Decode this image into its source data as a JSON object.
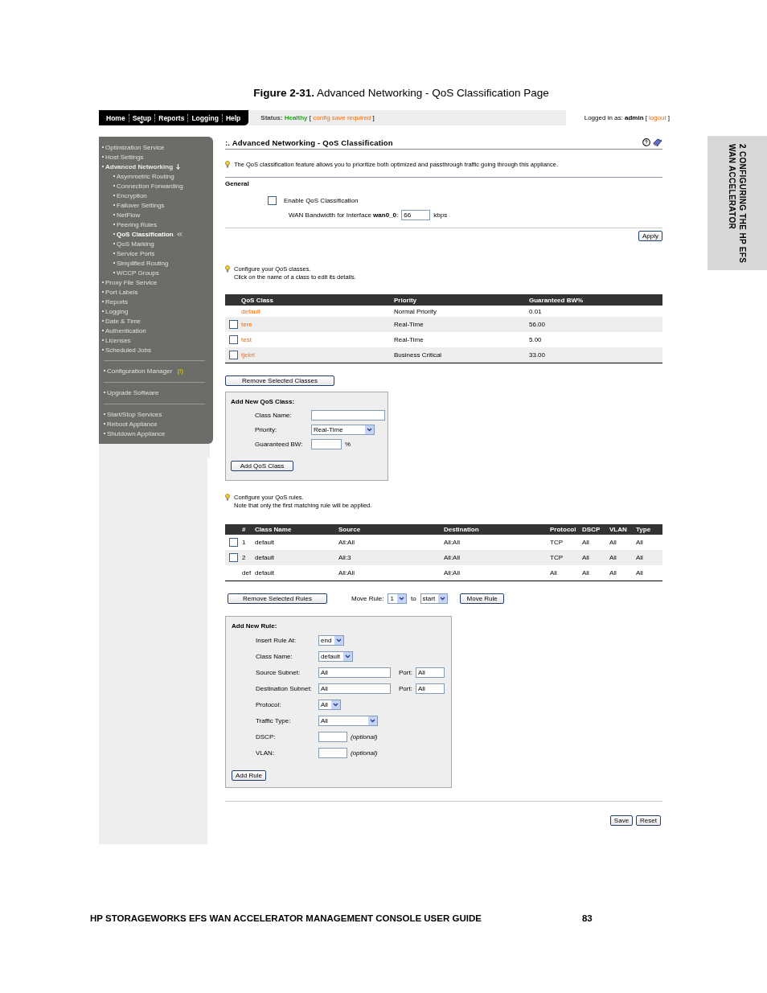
{
  "figure_caption": {
    "label": "Figure 2-31.",
    "text": "Advanced Networking - QoS Classification Page"
  },
  "side_tab": {
    "line_1": "2 CONFIGURING THE HP EFS",
    "line_2": "WAN ACCELERATOR"
  },
  "nav": [
    {
      "label": "Home",
      "selected": false
    },
    {
      "label": "Setup",
      "selected": true
    },
    {
      "label": "Reports",
      "selected": false
    },
    {
      "label": "Logging",
      "selected": false
    },
    {
      "label": "Help",
      "selected": false
    }
  ],
  "status": {
    "label": "Status:",
    "value": "Healthy",
    "bracket_open": "[",
    "note": "config save required",
    "bracket_close": "]"
  },
  "login": {
    "prefix": "Logged in as: **admin** [",
    "link": "logout",
    "suffix": "]"
  },
  "sidebar": [
    {
      "items": [
        {
          "label": "Optimization Service",
          "selected": false
        },
        {
          "label": "Host Settings",
          "selected": false
        },
        {
          "label": "Advanced Networking",
          "selected": false,
          "expanded": true,
          "children": [
            {
              "label": "Asymmetric Routing",
              "selected": false
            },
            {
              "label": "Connection Forwarding",
              "selected": false
            },
            {
              "label": "Encryption",
              "selected": false
            },
            {
              "label": "Failover Settings",
              "selected": false
            },
            {
              "label": "NetFlow",
              "selected": false
            },
            {
              "label": "Peering Rules",
              "selected": false
            },
            {
              "label": "QoS Classification",
              "selected": true
            },
            {
              "label": "QoS Marking",
              "selected": false
            },
            {
              "label": "Service Ports",
              "selected": false
            },
            {
              "label": "Simplified Routing",
              "selected": false
            },
            {
              "label": "WCCP Groups",
              "selected": false
            }
          ]
        },
        {
          "label": "Proxy File Service",
          "selected": false
        },
        {
          "label": "Port Labels",
          "selected": false
        },
        {
          "label": "Reports",
          "selected": false
        },
        {
          "label": "Logging",
          "selected": false
        },
        {
          "label": "Date & Time",
          "selected": false
        },
        {
          "label": "Authentication",
          "selected": false
        },
        {
          "label": "Licenses",
          "selected": false
        },
        {
          "label": "Scheduled Jobs",
          "selected": false
        }
      ]
    },
    {
      "items": [
        {
          "label": "Configuration Manager",
          "selected": false,
          "badge": "(!)"
        }
      ]
    },
    {
      "items": [
        {
          "label": "Upgrade Software",
          "selected": false
        }
      ]
    },
    {
      "items": [
        {
          "label": "Start/Stop Services",
          "selected": false
        },
        {
          "label": "Reboot Appliance",
          "selected": false
        },
        {
          "label": "Shutdown Appliance",
          "selected": false
        }
      ]
    }
  ],
  "page_title": ":. Advanced Networking - QoS Classification",
  "intro": "The QoS classification feature allows you to prioritize both optimized and passthrough traffic going through this appliance.",
  "general": {
    "heading": "General",
    "enable": {
      "label": "Enable QoS Classification",
      "checked": false
    },
    "bandwidth": {
      "label": "WAN Bandwidth for Interface **wan0_0**:",
      "value": "66",
      "unit": "kbps"
    },
    "apply": "Apply"
  },
  "classes": {
    "hint": [
      "Configure your QoS classes.",
      "Click on the name of a class to edit its details."
    ],
    "columns": [
      "QoS Class",
      "Priority",
      "Guaranteed BW%"
    ],
    "rows": [
      {
        "name": "default",
        "priority": "Normal Priority",
        "bandwidth": "0.01"
      },
      {
        "checked": false,
        "name": "tere",
        "priority": "Real-Time",
        "bandwidth": "56.00"
      },
      {
        "checked": false,
        "name": "test",
        "priority": "Real-Time",
        "bandwidth": "5.00"
      },
      {
        "checked": false,
        "name": "tjekrl",
        "priority": "Business Critical",
        "bandwidth": "33.00"
      }
    ],
    "remove": "Remove Selected Classes"
  },
  "add_class": {
    "title": "Add New QoS Class:",
    "fields": [
      {
        "kind": "text",
        "label": "Class Name:"
      },
      {
        "kind": "select",
        "label": "Priority:",
        "value": "Real-Time"
      },
      {
        "kind": "text",
        "label": "Guaranteed BW:",
        "unit": "%"
      }
    ],
    "button": "Add QoS Class"
  },
  "rules": {
    "hint": [
      "Configure your QoS rules.",
      "Note that only the first matching rule will be applied."
    ],
    "columns": [
      "#",
      "Class Name",
      "Source",
      "Destination",
      "Protocol",
      "DSCP",
      "VLAN",
      "Type"
    ],
    "rows": [
      {
        "checked": false,
        "cells": [
          "1",
          "default",
          "All:All",
          "All:All",
          "TCP",
          "All",
          "All",
          "All"
        ]
      },
      {
        "checked": false,
        "cells": [
          "2",
          "default",
          "All:3",
          "All:All",
          "TCP",
          "All",
          "All",
          "All"
        ]
      },
      {
        "cells": [
          "def",
          "default",
          "All:All",
          "All:All",
          "All",
          "All",
          "All",
          "All"
        ]
      }
    ],
    "remove": "Remove Selected Rules",
    "move_label": "Move Rule:",
    "move_from": "1",
    "to_label": "to",
    "move_to": "start",
    "move_button": "Move Rule"
  },
  "add_rule": {
    "title": "Add New Rule:",
    "fields": [
      {
        "kind": "select",
        "label": "Insert Rule At:",
        "value": "end"
      },
      {
        "kind": "select",
        "label": "Class Name:",
        "value": "default"
      },
      {
        "kind": "port",
        "label": "Source Subnet:",
        "value": "All",
        "port_label": "Port:",
        "port_value": "All"
      },
      {
        "kind": "port",
        "label": "Destination Subnet:",
        "value": "All",
        "port_label": "Port:",
        "port_value": "All"
      },
      {
        "kind": "select",
        "label": "Protocol:",
        "value": "All"
      },
      {
        "kind": "select",
        "label": "Traffic Type:",
        "value": "All"
      },
      {
        "kind": "optional",
        "label": "DSCP:",
        "note": "(optional)"
      },
      {
        "kind": "optional",
        "label": "VLAN:",
        "note": "(optional)"
      }
    ],
    "button": "Add Rule"
  },
  "actions": [
    "Save",
    "Reset"
  ],
  "footer": {
    "title": "HP STORAGEWORKS EFS WAN ACCELERATOR MANAGEMENT CONSOLE USER GUIDE",
    "page": "83"
  }
}
